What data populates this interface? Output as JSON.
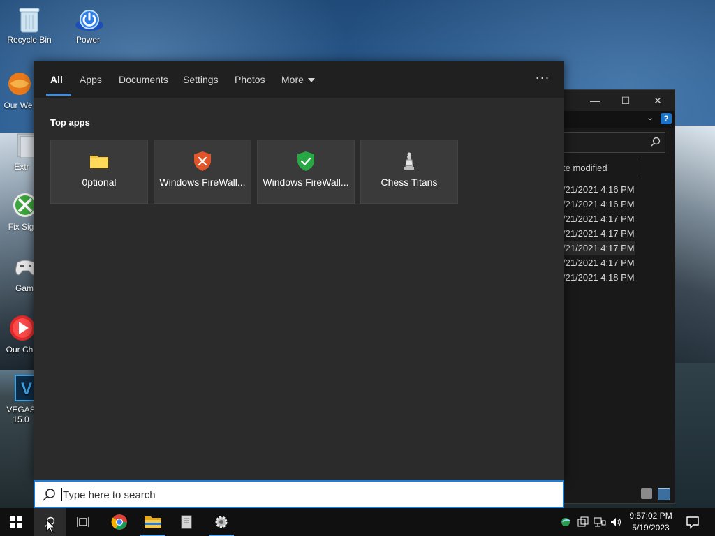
{
  "desktop": {
    "icons": [
      {
        "label": "Recycle Bin"
      },
      {
        "label": "Power"
      },
      {
        "label": "Our We"
      },
      {
        "label": "Extr"
      },
      {
        "label": "Fix Sig"
      },
      {
        "label": "Gam"
      },
      {
        "label": "Our Ch"
      },
      {
        "label": "VEGAS",
        "label2": "15.0"
      }
    ]
  },
  "explorer": {
    "column_header": "te modified",
    "rows": [
      "/21/2021 4:16 PM",
      "/21/2021 4:16 PM",
      "/21/2021 4:17 PM",
      "/21/2021 4:17 PM",
      "/21/2021 4:17 PM",
      "/21/2021 4:17 PM",
      "/21/2021 4:18 PM"
    ],
    "help_label": "?"
  },
  "search_panel": {
    "tabs": [
      {
        "label": "All"
      },
      {
        "label": "Apps"
      },
      {
        "label": "Documents"
      },
      {
        "label": "Settings"
      },
      {
        "label": "Photos"
      },
      {
        "label": "More"
      }
    ],
    "ellipsis": "···",
    "section_title": "Top apps",
    "apps": [
      {
        "label": "0ptional",
        "icon": "folder-icon"
      },
      {
        "label": "Windows FireWall...",
        "icon": "shield-x-icon"
      },
      {
        "label": "Windows FireWall...",
        "icon": "shield-check-icon"
      },
      {
        "label": "Chess Titans",
        "icon": "chess-icon"
      }
    ]
  },
  "search": {
    "placeholder": "Type here to search",
    "value": ""
  },
  "taskbar": {
    "time": "9:57:02 PM",
    "date": "5/19/2023"
  },
  "colors": {
    "accent": "#1f7ed6",
    "panel_bg": "#2b2b2b",
    "tabbar_bg": "#202020",
    "tile_bg": "#3a3a3a",
    "taskbar_bg": "#101010"
  }
}
